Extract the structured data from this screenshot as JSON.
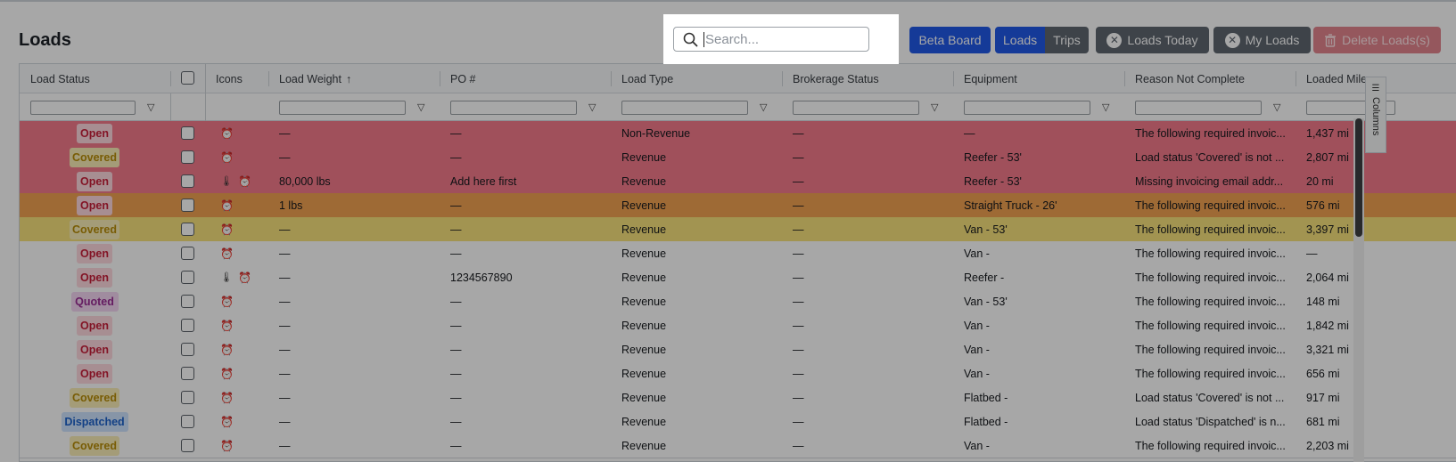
{
  "page": {
    "title": "Loads"
  },
  "search": {
    "placeholder": "Search...",
    "value": ""
  },
  "toolbar": {
    "beta_board": "Beta Board",
    "view_loads": "Loads",
    "view_trips": "Trips",
    "loads_today": "Loads Today",
    "my_loads": "My Loads",
    "delete_loads": "Delete Loads(s)"
  },
  "columns": [
    "Load Status",
    "",
    "Icons",
    "Load Weight",
    "PO #",
    "Load Type",
    "Brokerage Status",
    "Equipment",
    "Reason Not Complete",
    "Loaded Mile"
  ],
  "sort_indicator": "↑",
  "side_tab": {
    "label": "Columns"
  },
  "colors": {
    "accent": "#2059e8",
    "neutral_button": "#5f6770",
    "danger_button": "#e4858e",
    "row_red": "#f47a8c",
    "row_orange": "#f2a252",
    "row_yellow": "#f7e27c"
  },
  "rows": [
    {
      "status": "Open",
      "kind": "open",
      "bg": "red",
      "icons": [
        "alarm"
      ],
      "weight": "—",
      "po": "—",
      "type": "Non-Revenue",
      "brokerage": "—",
      "equipment": "—",
      "reason": "The following required invoic...",
      "miles": "1,437 mi"
    },
    {
      "status": "Covered",
      "kind": "covered",
      "bg": "red",
      "icons": [
        "alarm"
      ],
      "weight": "—",
      "po": "—",
      "type": "Revenue",
      "brokerage": "—",
      "equipment": "Reefer - 53'",
      "reason": "Load status 'Covered' is not ...",
      "miles": "2,807 mi"
    },
    {
      "status": "Open",
      "kind": "open",
      "bg": "red",
      "icons": [
        "thermo",
        "alarm"
      ],
      "weight": "80,000 lbs",
      "po": "Add here first",
      "type": "Revenue",
      "brokerage": "—",
      "equipment": "Reefer - 53'",
      "reason": "Missing invoicing email addr...",
      "miles": "20 mi"
    },
    {
      "status": "Open",
      "kind": "open",
      "bg": "orange",
      "icons": [
        "alarm"
      ],
      "weight": "1 lbs",
      "po": "—",
      "type": "Revenue",
      "brokerage": "—",
      "equipment": "Straight Truck - 26'",
      "reason": "The following required invoic...",
      "miles": "576 mi"
    },
    {
      "status": "Covered",
      "kind": "covered",
      "bg": "yellow",
      "icons": [
        "alarm"
      ],
      "weight": "—",
      "po": "—",
      "type": "Revenue",
      "brokerage": "—",
      "equipment": "Van - 53'",
      "reason": "The following required invoic...",
      "miles": "3,397 mi"
    },
    {
      "status": "Open",
      "kind": "open",
      "bg": "white",
      "icons": [
        "alarm"
      ],
      "weight": "—",
      "po": "—",
      "type": "Revenue",
      "brokerage": "—",
      "equipment": "Van -",
      "reason": "The following required invoic...",
      "miles": "—"
    },
    {
      "status": "Open",
      "kind": "open",
      "bg": "white",
      "icons": [
        "thermo",
        "alarm"
      ],
      "weight": "—",
      "po": "1234567890",
      "type": "Revenue",
      "brokerage": "—",
      "equipment": "Reefer -",
      "reason": "The following required invoic...",
      "miles": "2,064 mi"
    },
    {
      "status": "Quoted",
      "kind": "quoted",
      "bg": "white",
      "icons": [
        "alarm"
      ],
      "weight": "—",
      "po": "—",
      "type": "Revenue",
      "brokerage": "—",
      "equipment": "Van - 53'",
      "reason": "The following required invoic...",
      "miles": "148 mi"
    },
    {
      "status": "Open",
      "kind": "open",
      "bg": "white",
      "icons": [
        "alarm"
      ],
      "weight": "—",
      "po": "—",
      "type": "Revenue",
      "brokerage": "—",
      "equipment": "Van -",
      "reason": "The following required invoic...",
      "miles": "1,842 mi"
    },
    {
      "status": "Open",
      "kind": "open",
      "bg": "white",
      "icons": [
        "alarm"
      ],
      "weight": "—",
      "po": "—",
      "type": "Revenue",
      "brokerage": "—",
      "equipment": "Van -",
      "reason": "The following required invoic...",
      "miles": "3,321 mi"
    },
    {
      "status": "Open",
      "kind": "open",
      "bg": "white",
      "icons": [
        "alarm"
      ],
      "weight": "—",
      "po": "—",
      "type": "Revenue",
      "brokerage": "—",
      "equipment": "Van -",
      "reason": "The following required invoic...",
      "miles": "656 mi"
    },
    {
      "status": "Covered",
      "kind": "covered",
      "bg": "white",
      "icons": [
        "alarm"
      ],
      "weight": "—",
      "po": "—",
      "type": "Revenue",
      "brokerage": "—",
      "equipment": "Flatbed -",
      "reason": "Load status 'Covered' is not ...",
      "miles": "917 mi"
    },
    {
      "status": "Dispatched",
      "kind": "dispatched",
      "bg": "white",
      "icons": [
        "alarm"
      ],
      "weight": "—",
      "po": "—",
      "type": "Revenue",
      "brokerage": "—",
      "equipment": "Flatbed -",
      "reason": "Load status 'Dispatched' is n...",
      "miles": "681 mi"
    },
    {
      "status": "Covered",
      "kind": "covered",
      "bg": "white",
      "icons": [
        "alarm"
      ],
      "weight": "—",
      "po": "—",
      "type": "Revenue",
      "brokerage": "—",
      "equipment": "Van -",
      "reason": "The following required invoic...",
      "miles": "2,203 mi"
    }
  ]
}
